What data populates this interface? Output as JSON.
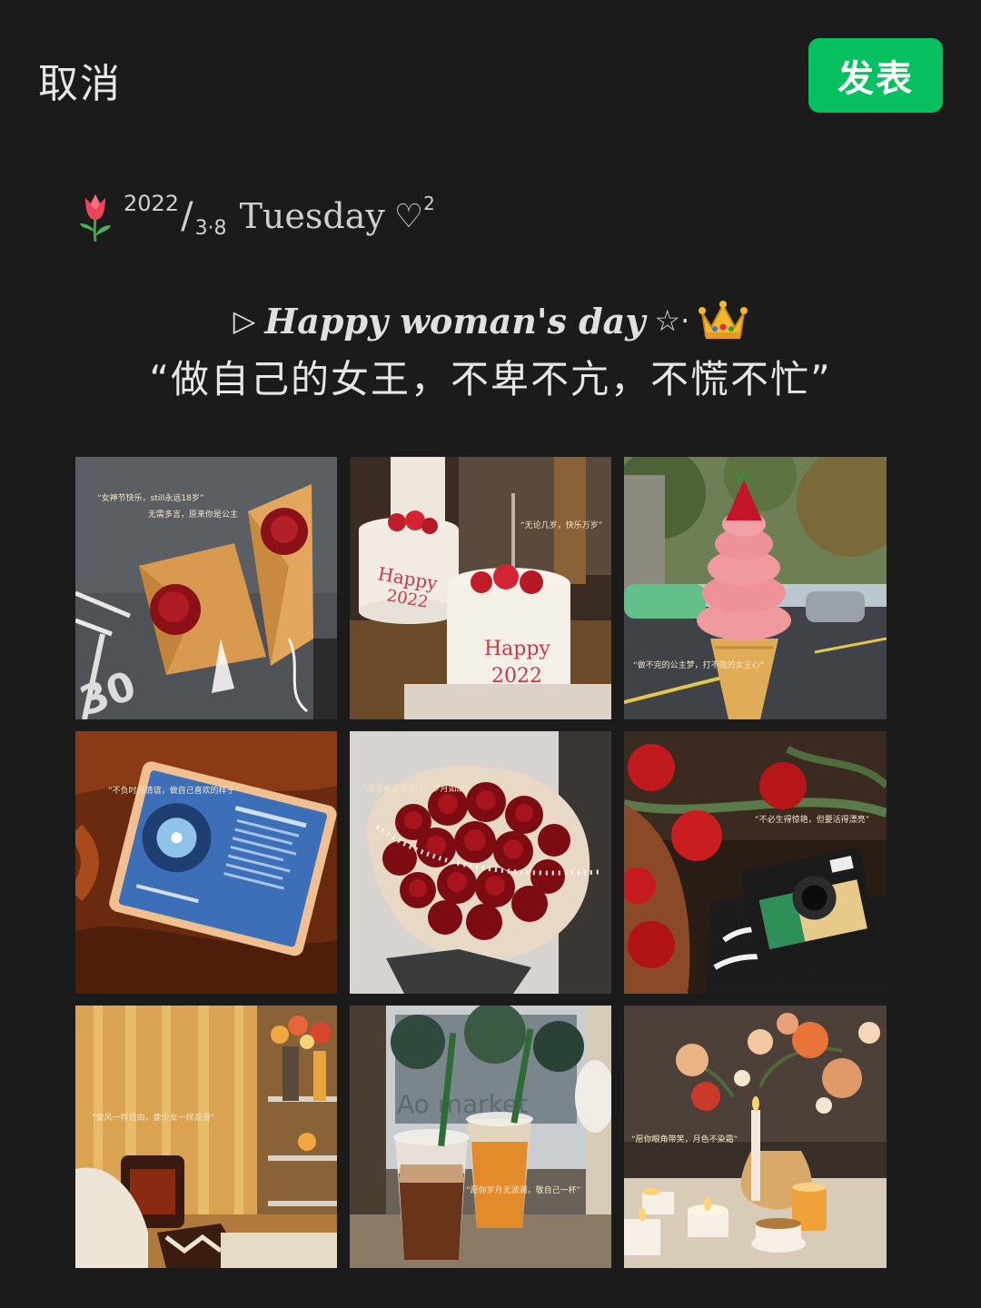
{
  "header": {
    "cancel_label": "取消",
    "publish_label": "发表",
    "publish_color": "#07c160"
  },
  "post": {
    "date_emoji": "tulip-icon",
    "year": "2022",
    "slash": "/",
    "month_day": "3·8",
    "weekday": "Tuesday",
    "heart": "♡",
    "heart_sup": "2",
    "heading_prefix": "▷",
    "heading": "Happy woman's day",
    "heading_star": "☆·",
    "heading_emoji": "crown-icon",
    "quote": "“做自己的女王，不卑不亢，不慌不忙”"
  },
  "photos": [
    {
      "subject": "rose-bouquet-photo",
      "captions": [
        "“女神节快乐，still永远18岁”",
        "无需多言，原来你是公主"
      ]
    },
    {
      "subject": "happy-2022-cakes-photo",
      "captions": [
        "“无论几岁，快乐万岁”"
      ],
      "cake_text_1": "Happy",
      "cake_text_2": "2022"
    },
    {
      "subject": "strawberry-ice-cream-photo",
      "captions": [
        "“做不完的公主梦，打不败的女王心”"
      ]
    },
    {
      "subject": "tablet-music-photo",
      "captions": [
        "“不负时光情谊，做自己喜欢的样子”"
      ]
    },
    {
      "subject": "red-rose-pearl-bouquet-photo",
      "captions": [
        "“愿你被温柔以待，岁月如故”"
      ]
    },
    {
      "subject": "tomatoes-camera-photo",
      "captions": [
        "“不必生得惊艳，但要活得漂亮”"
      ]
    },
    {
      "subject": "cozy-room-photo",
      "captions": [
        "“像风一样自由，像少女一样浪漫”"
      ]
    },
    {
      "subject": "iced-drinks-photo",
      "captions": [
        "“愿你岁月无波澜，敬自己一杯”"
      ],
      "window_text": "Ao market"
    },
    {
      "subject": "candles-flowers-photo",
      "captions": [
        "“愿你眼角带笑，月色不染霜”"
      ]
    }
  ]
}
